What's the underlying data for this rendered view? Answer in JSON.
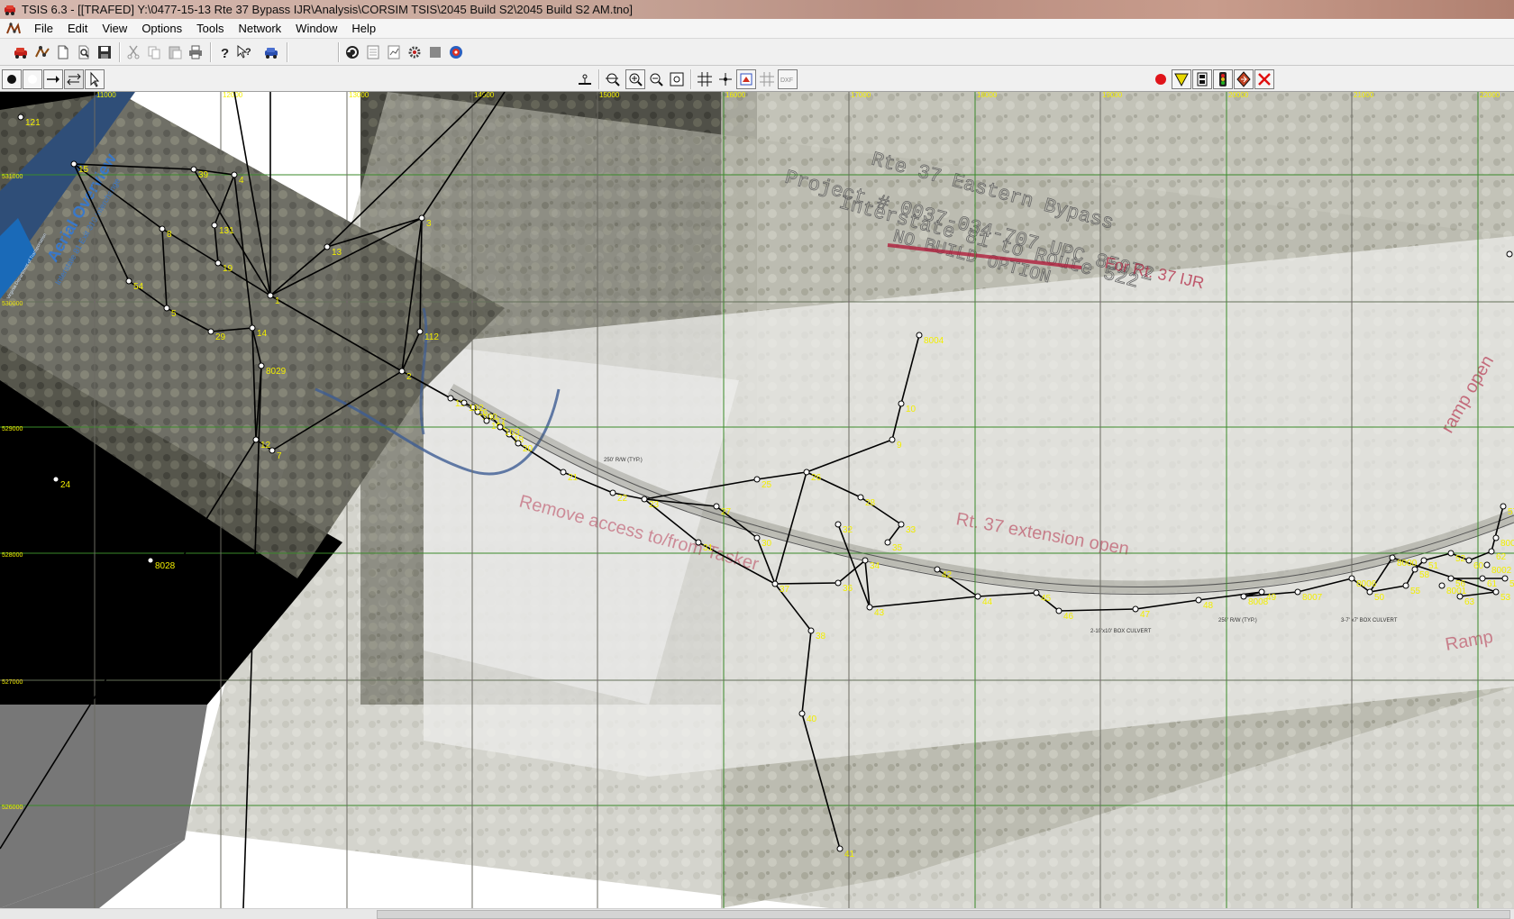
{
  "window": {
    "title": "TSIS 6.3 - [[TRAFED] Y:\\0477-15-13 Rte 37 Bypass IJR\\Analysis\\CORSIM TSIS\\2045 Build S2\\2045 Build S2 AM.tno]"
  },
  "menu": {
    "items": [
      "File",
      "Edit",
      "View",
      "Options",
      "Tools",
      "Network",
      "Window",
      "Help"
    ]
  },
  "toolbar": {
    "main_icons": [
      "open-car-icon",
      "network-icon",
      "new-icon",
      "find-icon",
      "save-icon",
      "cut-icon",
      "copy-icon",
      "paste-icon",
      "print-icon",
      "help-icon",
      "context-help-icon",
      "car-icon",
      "refresh-icon",
      "page-icon",
      "report-icon",
      "gear-icon",
      "gray-square-icon",
      "run-icon"
    ],
    "edit_icons": [
      "add-node-icon",
      "circle-tool-icon",
      "add-link-icon",
      "bidirectional-link-icon",
      "select-pointer-icon"
    ],
    "view_icons": [
      "scale-icon",
      "zoom-extents-icon",
      "zoom-in-icon",
      "zoom-out-icon",
      "zoom-window-icon",
      "grid-icon",
      "snap-icon",
      "background-icon",
      "grid-disabled-icon",
      "dxf-icon"
    ],
    "right_icons": [
      "record-icon",
      "yield-sign-icon",
      "meter-icon",
      "signal-icon",
      "direction-icon",
      "delete-icon"
    ],
    "dxf_label": "DXF"
  },
  "map": {
    "grid_x_labels": [
      "11000",
      "12000",
      "13000",
      "14000",
      "15000",
      "16000",
      "17000",
      "18000",
      "19000",
      "20000",
      "21000",
      "22000"
    ],
    "grid_y_labels": [
      "531000",
      "530000",
      "529000",
      "528000",
      "527000",
      "526000"
    ],
    "aerial_text": {
      "title": "Aerial Overview",
      "subtitle": "Interstate 81 Exit 310 Interchange",
      "agency": "Virginia Department of Transportation"
    },
    "plan_text": {
      "line1": "Rte 37 Eastern Bypass",
      "line2": "Project # 0037-034-707 UPC 85972",
      "line3": "Interstate 81 to Route 522",
      "line4": "NO BUILD OPTION",
      "line5": "For Rt. 37 IJR",
      "note1": "Rt. 37 extension open",
      "note2": "Remove access to/from Tasker",
      "note3": "ramp open",
      "note4": "Ramp",
      "culvert1": "3-7' x7' BOX CULVERT",
      "culvert2": "250' R/W (TYP.)",
      "culvert3": "250' R/W (TYP.)",
      "culvert4": "2-10'x10' BOX CULVERT"
    },
    "nodes": [
      {
        "id": "121"
      },
      {
        "id": "15"
      },
      {
        "id": "39"
      },
      {
        "id": "4"
      },
      {
        "id": "8"
      },
      {
        "id": "131"
      },
      {
        "id": "54"
      },
      {
        "id": "19"
      },
      {
        "id": "13"
      },
      {
        "id": "3"
      },
      {
        "id": "1"
      },
      {
        "id": "5"
      },
      {
        "id": "29"
      },
      {
        "id": "14"
      },
      {
        "id": "112"
      },
      {
        "id": "8029"
      },
      {
        "id": "2"
      },
      {
        "id": "12"
      },
      {
        "id": "7"
      },
      {
        "id": "24"
      },
      {
        "id": "8028"
      },
      {
        "id": "8004"
      },
      {
        "id": "10"
      },
      {
        "id": "9"
      },
      {
        "id": "11"
      },
      {
        "id": "16"
      },
      {
        "id": "17"
      },
      {
        "id": "18"
      },
      {
        "id": "20"
      },
      {
        "id": "21"
      },
      {
        "id": "22"
      },
      {
        "id": "23"
      },
      {
        "id": "25"
      },
      {
        "id": "26"
      },
      {
        "id": "27"
      },
      {
        "id": "28"
      },
      {
        "id": "30"
      },
      {
        "id": "31"
      },
      {
        "id": "32"
      },
      {
        "id": "33"
      },
      {
        "id": "34"
      },
      {
        "id": "35"
      },
      {
        "id": "36"
      },
      {
        "id": "37"
      },
      {
        "id": "38"
      },
      {
        "id": "40"
      },
      {
        "id": "41"
      },
      {
        "id": "42"
      },
      {
        "id": "43"
      },
      {
        "id": "44"
      },
      {
        "id": "45"
      },
      {
        "id": "46"
      },
      {
        "id": "47"
      },
      {
        "id": "48"
      },
      {
        "id": "49"
      },
      {
        "id": "50"
      },
      {
        "id": "51"
      },
      {
        "id": "52"
      },
      {
        "id": "53"
      },
      {
        "id": "55"
      },
      {
        "id": "56"
      },
      {
        "id": "57"
      },
      {
        "id": "58"
      },
      {
        "id": "59"
      },
      {
        "id": "60"
      },
      {
        "id": "61"
      },
      {
        "id": "62"
      },
      {
        "id": "63"
      },
      {
        "id": "100"
      },
      {
        "id": "101"
      },
      {
        "id": "102"
      },
      {
        "id": "103"
      },
      {
        "id": "8000"
      },
      {
        "id": "8001"
      },
      {
        "id": "8002"
      },
      {
        "id": "8003"
      },
      {
        "id": "8005"
      },
      {
        "id": "8006"
      },
      {
        "id": "8007"
      },
      {
        "id": "8008"
      }
    ]
  },
  "colors": {
    "node_label": "#f2ee00",
    "grid_green": "#3a8a2a",
    "grid_magenta": "#b040b0",
    "link": "#000000",
    "annotation_red": "#b01e3c"
  }
}
